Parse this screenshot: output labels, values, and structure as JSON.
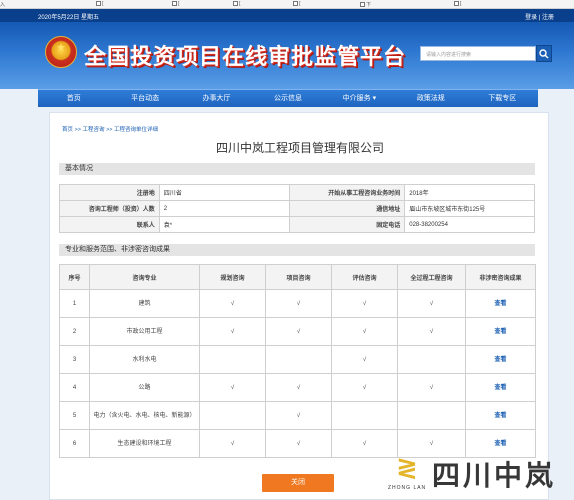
{
  "browser": {
    "bookmarks": [
      "入",
      "[",
      "[",
      "[",
      "[",
      "下",
      "["
    ]
  },
  "header": {
    "date": "2020年5月22日 星期五",
    "login": "登录",
    "separator": "|",
    "register": "注册",
    "site_title": "全国投资项目在线审批监管平台",
    "search_placeholder": "请输入内容进行搜索",
    "search_icon": "search-icon",
    "emblem": "national-emblem-icon"
  },
  "nav": {
    "items": [
      "首页",
      "平台动态",
      "办事大厅",
      "公示信息",
      "中介服务",
      "政策法规",
      "下载专区"
    ],
    "dropdown_indicator": "▾"
  },
  "breadcrumb": {
    "home": "首页",
    "sep": ">>",
    "level2": "工程咨询",
    "level3": "工程咨询单位详细"
  },
  "company_name": "四川中岚工程项目管理有限公司",
  "basic": {
    "title": "基本情况",
    "rows": [
      {
        "l1": "注册地",
        "v1": "四川省",
        "l2": "开始从事工程咨询业务时间",
        "v2": "2018年"
      },
      {
        "l1": "咨询工程师（投资）人数",
        "v1": "2",
        "l2": "通信地址",
        "v2": "眉山市东坡区城市东街125号"
      },
      {
        "l1": "联系人",
        "v1": "袁*",
        "l2": "固定电话",
        "v2": "028-38200254"
      }
    ]
  },
  "services": {
    "title": "专业和服务范围、非涉密咨询成果",
    "headers": [
      "序号",
      "咨询专业",
      "规划咨询",
      "项目咨询",
      "评估咨询",
      "全过程工程咨询",
      "非涉密咨询成果"
    ],
    "check": "√",
    "view_label": "查看",
    "rows": [
      {
        "no": "1",
        "name": "建筑",
        "c": [
          true,
          true,
          true,
          true
        ]
      },
      {
        "no": "2",
        "name": "市政公用工程",
        "c": [
          true,
          true,
          true,
          true
        ]
      },
      {
        "no": "3",
        "name": "水利水电",
        "c": [
          false,
          false,
          true,
          false
        ]
      },
      {
        "no": "4",
        "name": "公路",
        "c": [
          true,
          true,
          true,
          true
        ]
      },
      {
        "no": "5",
        "name": "电力（含火电、水电、核电、新能源）",
        "c": [
          false,
          true,
          false,
          false
        ]
      },
      {
        "no": "6",
        "name": "生态建设和环境工程",
        "c": [
          true,
          true,
          true,
          true
        ]
      }
    ]
  },
  "close_button": "关闭",
  "watermark": {
    "latin": "ZHONG LAN",
    "name": "四川中岚"
  },
  "colors": {
    "header_blue": "#1d64bf",
    "nav_blue": "#2f7dd8",
    "link_blue": "#1b5fb2",
    "close_orange": "#f07820",
    "title_red": "#d92b1e",
    "watermark_gold": "#e4b42a"
  }
}
